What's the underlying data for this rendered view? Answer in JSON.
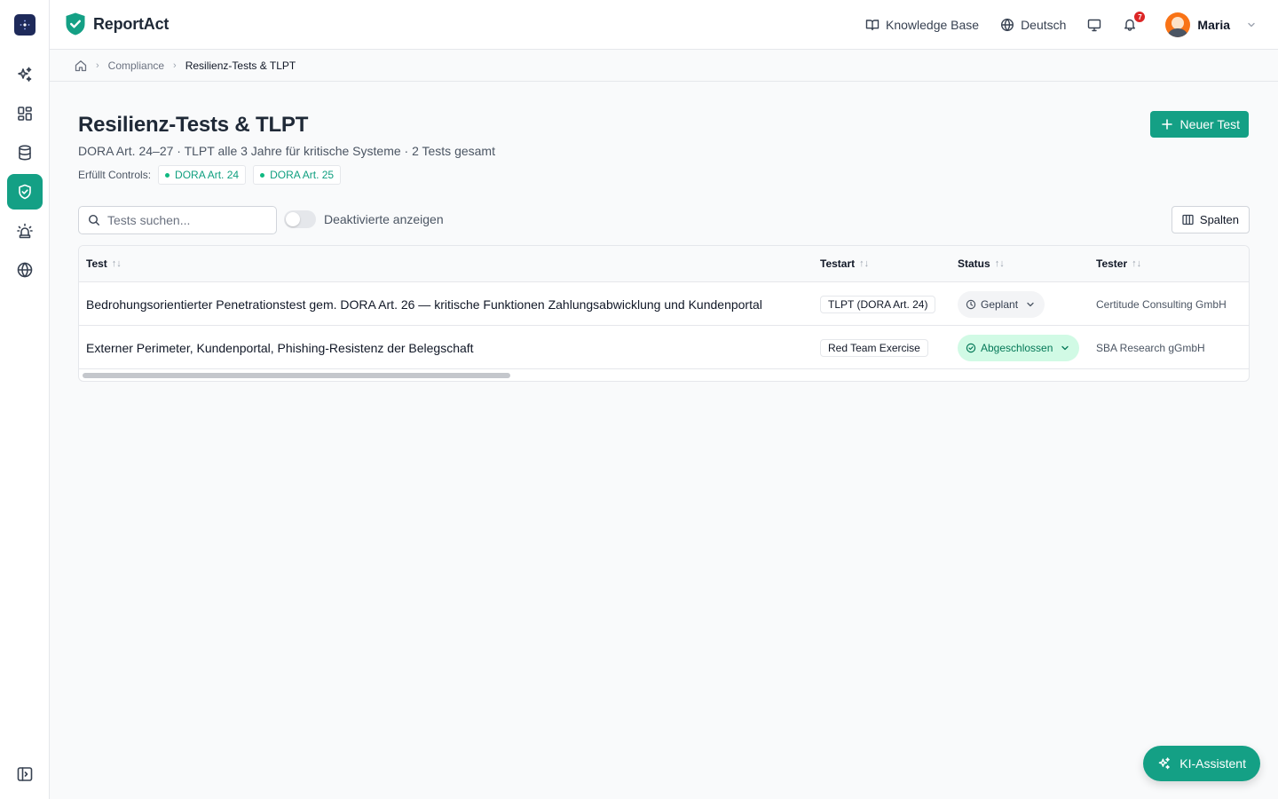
{
  "app": {
    "name": "ReportAct",
    "brand_color": "#14a085"
  },
  "topbar": {
    "knowledge_base": "Knowledge Base",
    "language": "Deutsch",
    "notifications_count": "7",
    "user_name": "Maria"
  },
  "breadcrumb": {
    "items": [
      "Compliance",
      "Resilienz-Tests & TLPT"
    ]
  },
  "header": {
    "title": "Resilienz-Tests & TLPT",
    "subtitle": "DORA Art. 24–27 · TLPT alle 3 Jahre für kritische Systeme · 2 Tests gesamt",
    "controls_label": "Erfüllt Controls:",
    "controls": [
      "DORA Art. 24",
      "DORA Art. 25"
    ],
    "new_button": "Neuer Test"
  },
  "toolbar": {
    "search_placeholder": "Tests suchen...",
    "toggle_label": "Deaktivierte anzeigen",
    "columns_button": "Spalten"
  },
  "table": {
    "columns": [
      "Test",
      "Testart",
      "Status",
      "Tester"
    ],
    "rows": [
      {
        "test": "Bedrohungsorientierter Penetrationstest gem. DORA Art. 26 — kritische Funktionen Zahlungsabwicklung und Kundenportal",
        "type": "TLPT (DORA Art. 24)",
        "status": "Geplant",
        "tester": "Certitude Consulting GmbH"
      },
      {
        "test": "Externer Perimeter, Kundenportal, Phishing-Resistenz der Belegschaft",
        "type": "Red Team Exercise",
        "status": "Abgeschlossen",
        "tester": "SBA Research gGmbH"
      }
    ]
  },
  "assistant": {
    "label": "KI-Assistent"
  }
}
